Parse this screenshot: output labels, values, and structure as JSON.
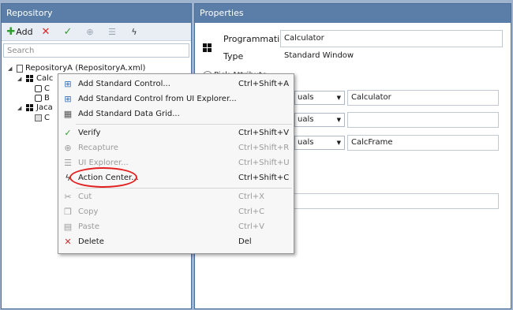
{
  "repository": {
    "title": "Repository",
    "toolbar": {
      "add_label": "Add"
    },
    "search_placeholder": "Search",
    "tree": {
      "root": "RepositoryA (RepositoryA.xml)",
      "calc": "Calc",
      "calc_child1": "C",
      "calc_child2": "B",
      "jaca": "Jaca",
      "jaca_child": "C"
    }
  },
  "properties": {
    "title": "Properties",
    "programmatic_id_label": "Programmatic Id",
    "programmatic_id_value": "Calculator",
    "type_label": "Type",
    "type_value": "Standard Window",
    "partial_label": "Pick Attribute",
    "rows": [
      {
        "op": "uals",
        "value": "Calculator"
      },
      {
        "op": "uals",
        "value": ""
      },
      {
        "op": "uals",
        "value": "CalcFrame"
      }
    ]
  },
  "context_menu": {
    "items": [
      {
        "label": "Add Standard Control...",
        "shortcut": "Ctrl+Shift+A"
      },
      {
        "label": "Add Standard Control from UI Explorer...",
        "shortcut": ""
      },
      {
        "label": "Add Standard Data Grid...",
        "shortcut": ""
      },
      {
        "label": "Verify",
        "shortcut": "Ctrl+Shift+V"
      },
      {
        "label": "Recapture",
        "shortcut": "Ctrl+Shift+R"
      },
      {
        "label": "UI Explorer...",
        "shortcut": "Ctrl+Shift+U"
      },
      {
        "label": "Action Center...",
        "shortcut": "Ctrl+Shift+C"
      },
      {
        "label": "Cut",
        "shortcut": "Ctrl+X"
      },
      {
        "label": "Copy",
        "shortcut": "Ctrl+C"
      },
      {
        "label": "Paste",
        "shortcut": "Ctrl+V"
      },
      {
        "label": "Delete",
        "shortcut": "Del"
      }
    ]
  },
  "colors": {
    "header": "#5b7ea8",
    "highlight_ring": "#e32020",
    "add_green": "#2f9e2f",
    "delete_red": "#d42a2a"
  }
}
